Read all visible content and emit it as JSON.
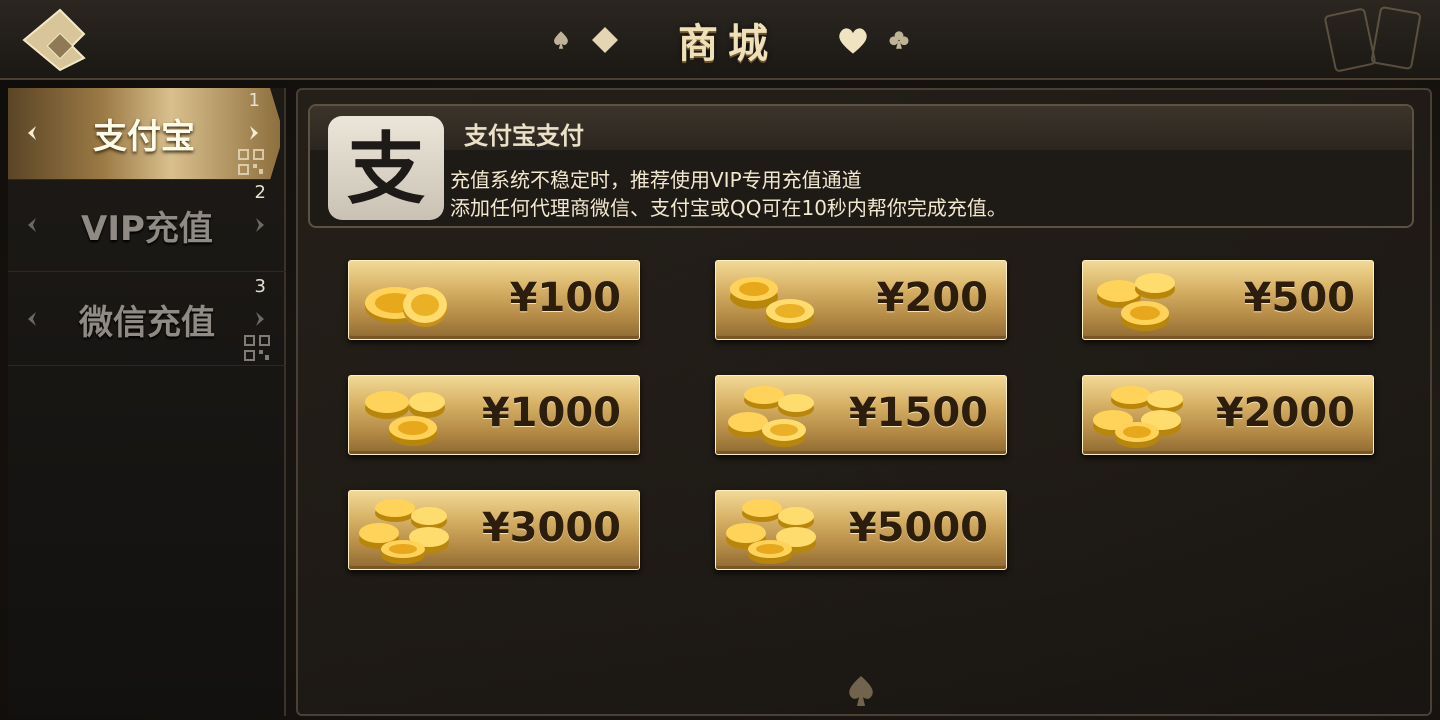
{
  "header": {
    "title": "商城",
    "back_icon": "back-arrow-icon",
    "title_icons": [
      "spade-icon",
      "diamond-icon",
      "heart-icon",
      "club-icon"
    ]
  },
  "sidebar": {
    "tabs": [
      {
        "label": "支付宝",
        "number": "1",
        "active": true
      },
      {
        "label": "VIP充值",
        "number": "2",
        "active": false
      },
      {
        "label": "微信充值",
        "number": "3",
        "active": false
      }
    ]
  },
  "info": {
    "title": "支付宝支付",
    "logo_glyph": "支",
    "line1": "充值系统不稳定时，推荐使用VIP专用充值通道",
    "line2": "添加任何代理商微信、支付宝或QQ可在10秒内帮你完成充值。"
  },
  "amounts": [
    {
      "label": "¥100"
    },
    {
      "label": "¥200"
    },
    {
      "label": "¥500"
    },
    {
      "label": "¥1000"
    },
    {
      "label": "¥1500"
    },
    {
      "label": "¥2000"
    },
    {
      "label": "¥3000"
    },
    {
      "label": "¥5000"
    }
  ],
  "colors": {
    "gold": "#d7b266",
    "background": "#17130f",
    "price_text": "#2d1d0d"
  }
}
